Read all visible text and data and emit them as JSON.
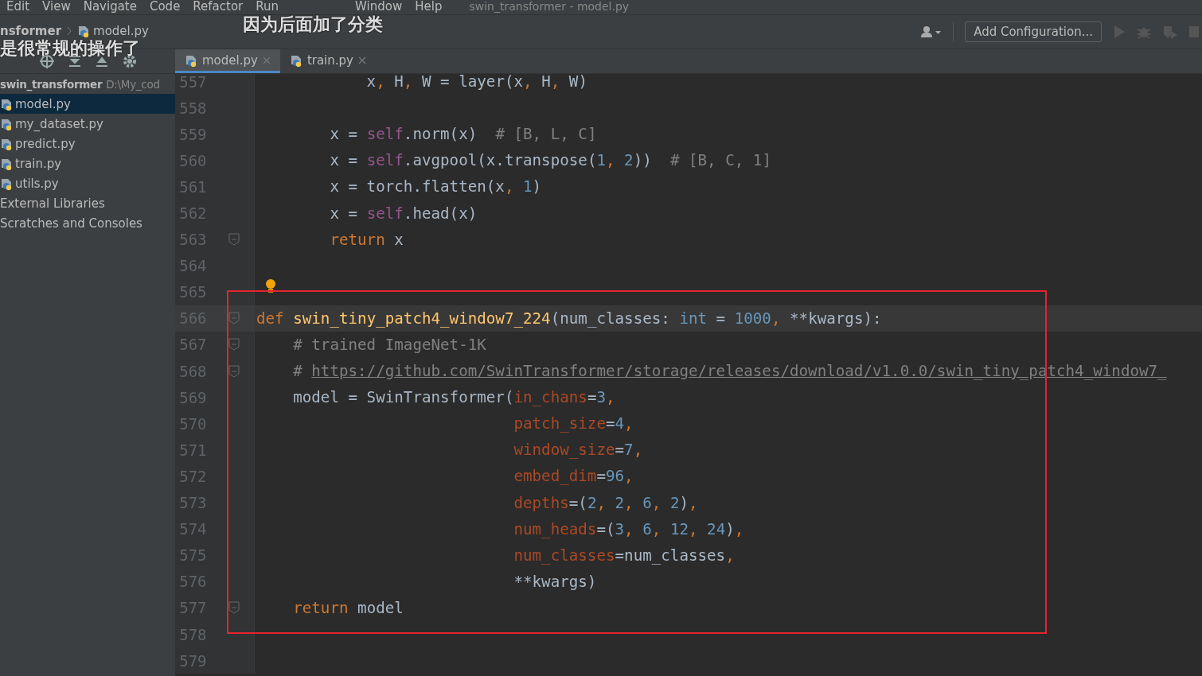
{
  "menu": [
    "Edit",
    "View",
    "Navigate",
    "Code",
    "Refactor",
    "Run",
    "Window",
    "Help"
  ],
  "window": {
    "title": "swin_transformer - model.py"
  },
  "subtitles": [
    "因为后面加了分类",
    "是很常规的操作了"
  ],
  "breadcrumb": [
    "nsformer",
    "model.py"
  ],
  "toolbar": {
    "config_button": "Add Configuration..."
  },
  "tabs": [
    {
      "label": "model.py",
      "selected": true
    },
    {
      "label": "train.py",
      "selected": false
    }
  ],
  "sidebar": {
    "root": {
      "name": "swin_transformer",
      "path": "D:\\My_cod"
    },
    "items": [
      {
        "kind": "file",
        "label": "model.py",
        "selected": true
      },
      {
        "kind": "file",
        "label": "my_dataset.py",
        "selected": false
      },
      {
        "kind": "file",
        "label": "predict.py",
        "selected": false
      },
      {
        "kind": "file",
        "label": "train.py",
        "selected": false
      },
      {
        "kind": "file",
        "label": "utils.py",
        "selected": false
      },
      {
        "kind": "group",
        "label": "External Libraries",
        "selected": false
      },
      {
        "kind": "group",
        "label": "Scratches and Consoles",
        "selected": false
      }
    ]
  },
  "editor": {
    "lines": [
      {
        "number": "557",
        "fold": false,
        "bulb": false,
        "current": false,
        "tokens": [
          {
            "kind": "plain",
            "t": "            x"
          },
          {
            "kind": "keyword",
            "t": ", "
          },
          {
            "kind": "plain",
            "t": "H"
          },
          {
            "kind": "keyword",
            "t": ", "
          },
          {
            "kind": "plain",
            "t": "W = layer(x"
          },
          {
            "kind": "keyword",
            "t": ", "
          },
          {
            "kind": "plain",
            "t": "H"
          },
          {
            "kind": "keyword",
            "t": ", "
          },
          {
            "kind": "plain",
            "t": "W)"
          }
        ]
      },
      {
        "number": "558",
        "fold": false,
        "bulb": false,
        "current": false
      },
      {
        "number": "559",
        "fold": false,
        "bulb": false,
        "current": false,
        "tokens": [
          {
            "kind": "plain",
            "t": "        x = "
          },
          {
            "kind": "self",
            "t": "self"
          },
          {
            "kind": "plain",
            "t": ".norm(x)  "
          },
          {
            "kind": "comment",
            "t": "# [B, L, C]"
          }
        ]
      },
      {
        "number": "560",
        "fold": false,
        "bulb": false,
        "current": false,
        "tokens": [
          {
            "kind": "plain",
            "t": "        x = "
          },
          {
            "kind": "self",
            "t": "self"
          },
          {
            "kind": "plain",
            "t": ".avgpool(x.transpose("
          },
          {
            "kind": "number",
            "t": "1"
          },
          {
            "kind": "keyword",
            "t": ", "
          },
          {
            "kind": "number",
            "t": "2"
          },
          {
            "kind": "plain",
            "t": "))  "
          },
          {
            "kind": "comment",
            "t": "# [B, C, 1]"
          }
        ]
      },
      {
        "number": "561",
        "fold": false,
        "bulb": false,
        "current": false,
        "tokens": [
          {
            "kind": "plain",
            "t": "        x = torch.flatten(x"
          },
          {
            "kind": "keyword",
            "t": ", "
          },
          {
            "kind": "number",
            "t": "1"
          },
          {
            "kind": "plain",
            "t": ")"
          }
        ]
      },
      {
        "number": "562",
        "fold": false,
        "bulb": false,
        "current": false,
        "tokens": [
          {
            "kind": "plain",
            "t": "        x = "
          },
          {
            "kind": "self",
            "t": "self"
          },
          {
            "kind": "plain",
            "t": ".head(x)"
          }
        ]
      },
      {
        "number": "563",
        "fold": true,
        "bulb": false,
        "current": false,
        "tokens": [
          {
            "kind": "keyword",
            "t": "        return "
          },
          {
            "kind": "plain",
            "t": "x"
          }
        ]
      },
      {
        "number": "564",
        "fold": false,
        "bulb": false,
        "current": false
      },
      {
        "number": "565",
        "fold": false,
        "bulb": true,
        "current": false
      },
      {
        "number": "566",
        "fold": true,
        "bulb": false,
        "current": true,
        "tokens": [
          {
            "kind": "keyword",
            "t": "def "
          },
          {
            "kind": "function",
            "t": "swin_tiny_patch4_window7_224"
          },
          {
            "kind": "plain",
            "t": "(num_classes: "
          },
          {
            "kind": "number",
            "t": "int"
          },
          {
            "kind": "plain",
            "t": " = "
          },
          {
            "kind": "number",
            "t": "1000"
          },
          {
            "kind": "keyword",
            "t": ", "
          },
          {
            "kind": "plain",
            "t": "**kwargs):"
          }
        ]
      },
      {
        "number": "567",
        "fold": true,
        "bulb": false,
        "current": false,
        "tokens": [
          {
            "kind": "comment",
            "t": "    # trained ImageNet-1K"
          }
        ]
      },
      {
        "number": "568",
        "fold": true,
        "bulb": false,
        "current": false,
        "tokens": [
          {
            "kind": "comment",
            "t": "    # "
          },
          {
            "kind": "link",
            "t": "https://github.com/SwinTransformer/storage/releases/download/v1.0.0/swin_tiny_patch4_window7_"
          }
        ]
      },
      {
        "number": "569",
        "fold": false,
        "bulb": false,
        "current": false,
        "tokens": [
          {
            "kind": "plain",
            "t": "    model = SwinTransformer("
          },
          {
            "kind": "argument",
            "t": "in_chans"
          },
          {
            "kind": "plain",
            "t": "="
          },
          {
            "kind": "number",
            "t": "3"
          },
          {
            "kind": "keyword",
            "t": ","
          }
        ]
      },
      {
        "number": "570",
        "fold": false,
        "bulb": false,
        "current": false,
        "tokens": [
          {
            "kind": "argument",
            "t": "                            patch_size"
          },
          {
            "kind": "plain",
            "t": "="
          },
          {
            "kind": "number",
            "t": "4"
          },
          {
            "kind": "keyword",
            "t": ","
          }
        ]
      },
      {
        "number": "571",
        "fold": false,
        "bulb": false,
        "current": false,
        "tokens": [
          {
            "kind": "argument",
            "t": "                            window_size"
          },
          {
            "kind": "plain",
            "t": "="
          },
          {
            "kind": "number",
            "t": "7"
          },
          {
            "kind": "keyword",
            "t": ","
          }
        ]
      },
      {
        "number": "572",
        "fold": false,
        "bulb": false,
        "current": false,
        "tokens": [
          {
            "kind": "argument",
            "t": "                            embed_dim"
          },
          {
            "kind": "plain",
            "t": "="
          },
          {
            "kind": "number",
            "t": "96"
          },
          {
            "kind": "keyword",
            "t": ","
          }
        ]
      },
      {
        "number": "573",
        "fold": false,
        "bulb": false,
        "current": false,
        "tokens": [
          {
            "kind": "argument",
            "t": "                            depths"
          },
          {
            "kind": "plain",
            "t": "=("
          },
          {
            "kind": "number",
            "t": "2"
          },
          {
            "kind": "keyword",
            "t": ", "
          },
          {
            "kind": "number",
            "t": "2"
          },
          {
            "kind": "keyword",
            "t": ", "
          },
          {
            "kind": "number",
            "t": "6"
          },
          {
            "kind": "keyword",
            "t": ", "
          },
          {
            "kind": "number",
            "t": "2"
          },
          {
            "kind": "plain",
            "t": ")"
          },
          {
            "kind": "keyword",
            "t": ","
          }
        ]
      },
      {
        "number": "574",
        "fold": false,
        "bulb": false,
        "current": false,
        "tokens": [
          {
            "kind": "argument",
            "t": "                            num_heads"
          },
          {
            "kind": "plain",
            "t": "=("
          },
          {
            "kind": "number",
            "t": "3"
          },
          {
            "kind": "keyword",
            "t": ", "
          },
          {
            "kind": "number",
            "t": "6"
          },
          {
            "kind": "keyword",
            "t": ", "
          },
          {
            "kind": "number",
            "t": "12"
          },
          {
            "kind": "keyword",
            "t": ", "
          },
          {
            "kind": "number",
            "t": "24"
          },
          {
            "kind": "plain",
            "t": ")"
          },
          {
            "kind": "keyword",
            "t": ","
          }
        ]
      },
      {
        "number": "575",
        "fold": false,
        "bulb": false,
        "current": false,
        "tokens": [
          {
            "kind": "argument",
            "t": "                            num_classes"
          },
          {
            "kind": "plain",
            "t": "=num_classes"
          },
          {
            "kind": "keyword",
            "t": ","
          }
        ]
      },
      {
        "number": "576",
        "fold": false,
        "bulb": false,
        "current": false,
        "tokens": [
          {
            "kind": "plain",
            "t": "                            **kwargs)"
          }
        ]
      },
      {
        "number": "577",
        "fold": true,
        "bulb": false,
        "current": false,
        "tokens": [
          {
            "kind": "keyword",
            "t": "    return "
          },
          {
            "kind": "plain",
            "t": "model"
          }
        ]
      },
      {
        "number": "578",
        "fold": false,
        "bulb": false,
        "current": false
      },
      {
        "number": "579",
        "fold": false,
        "bulb": false,
        "current": false
      }
    ]
  }
}
